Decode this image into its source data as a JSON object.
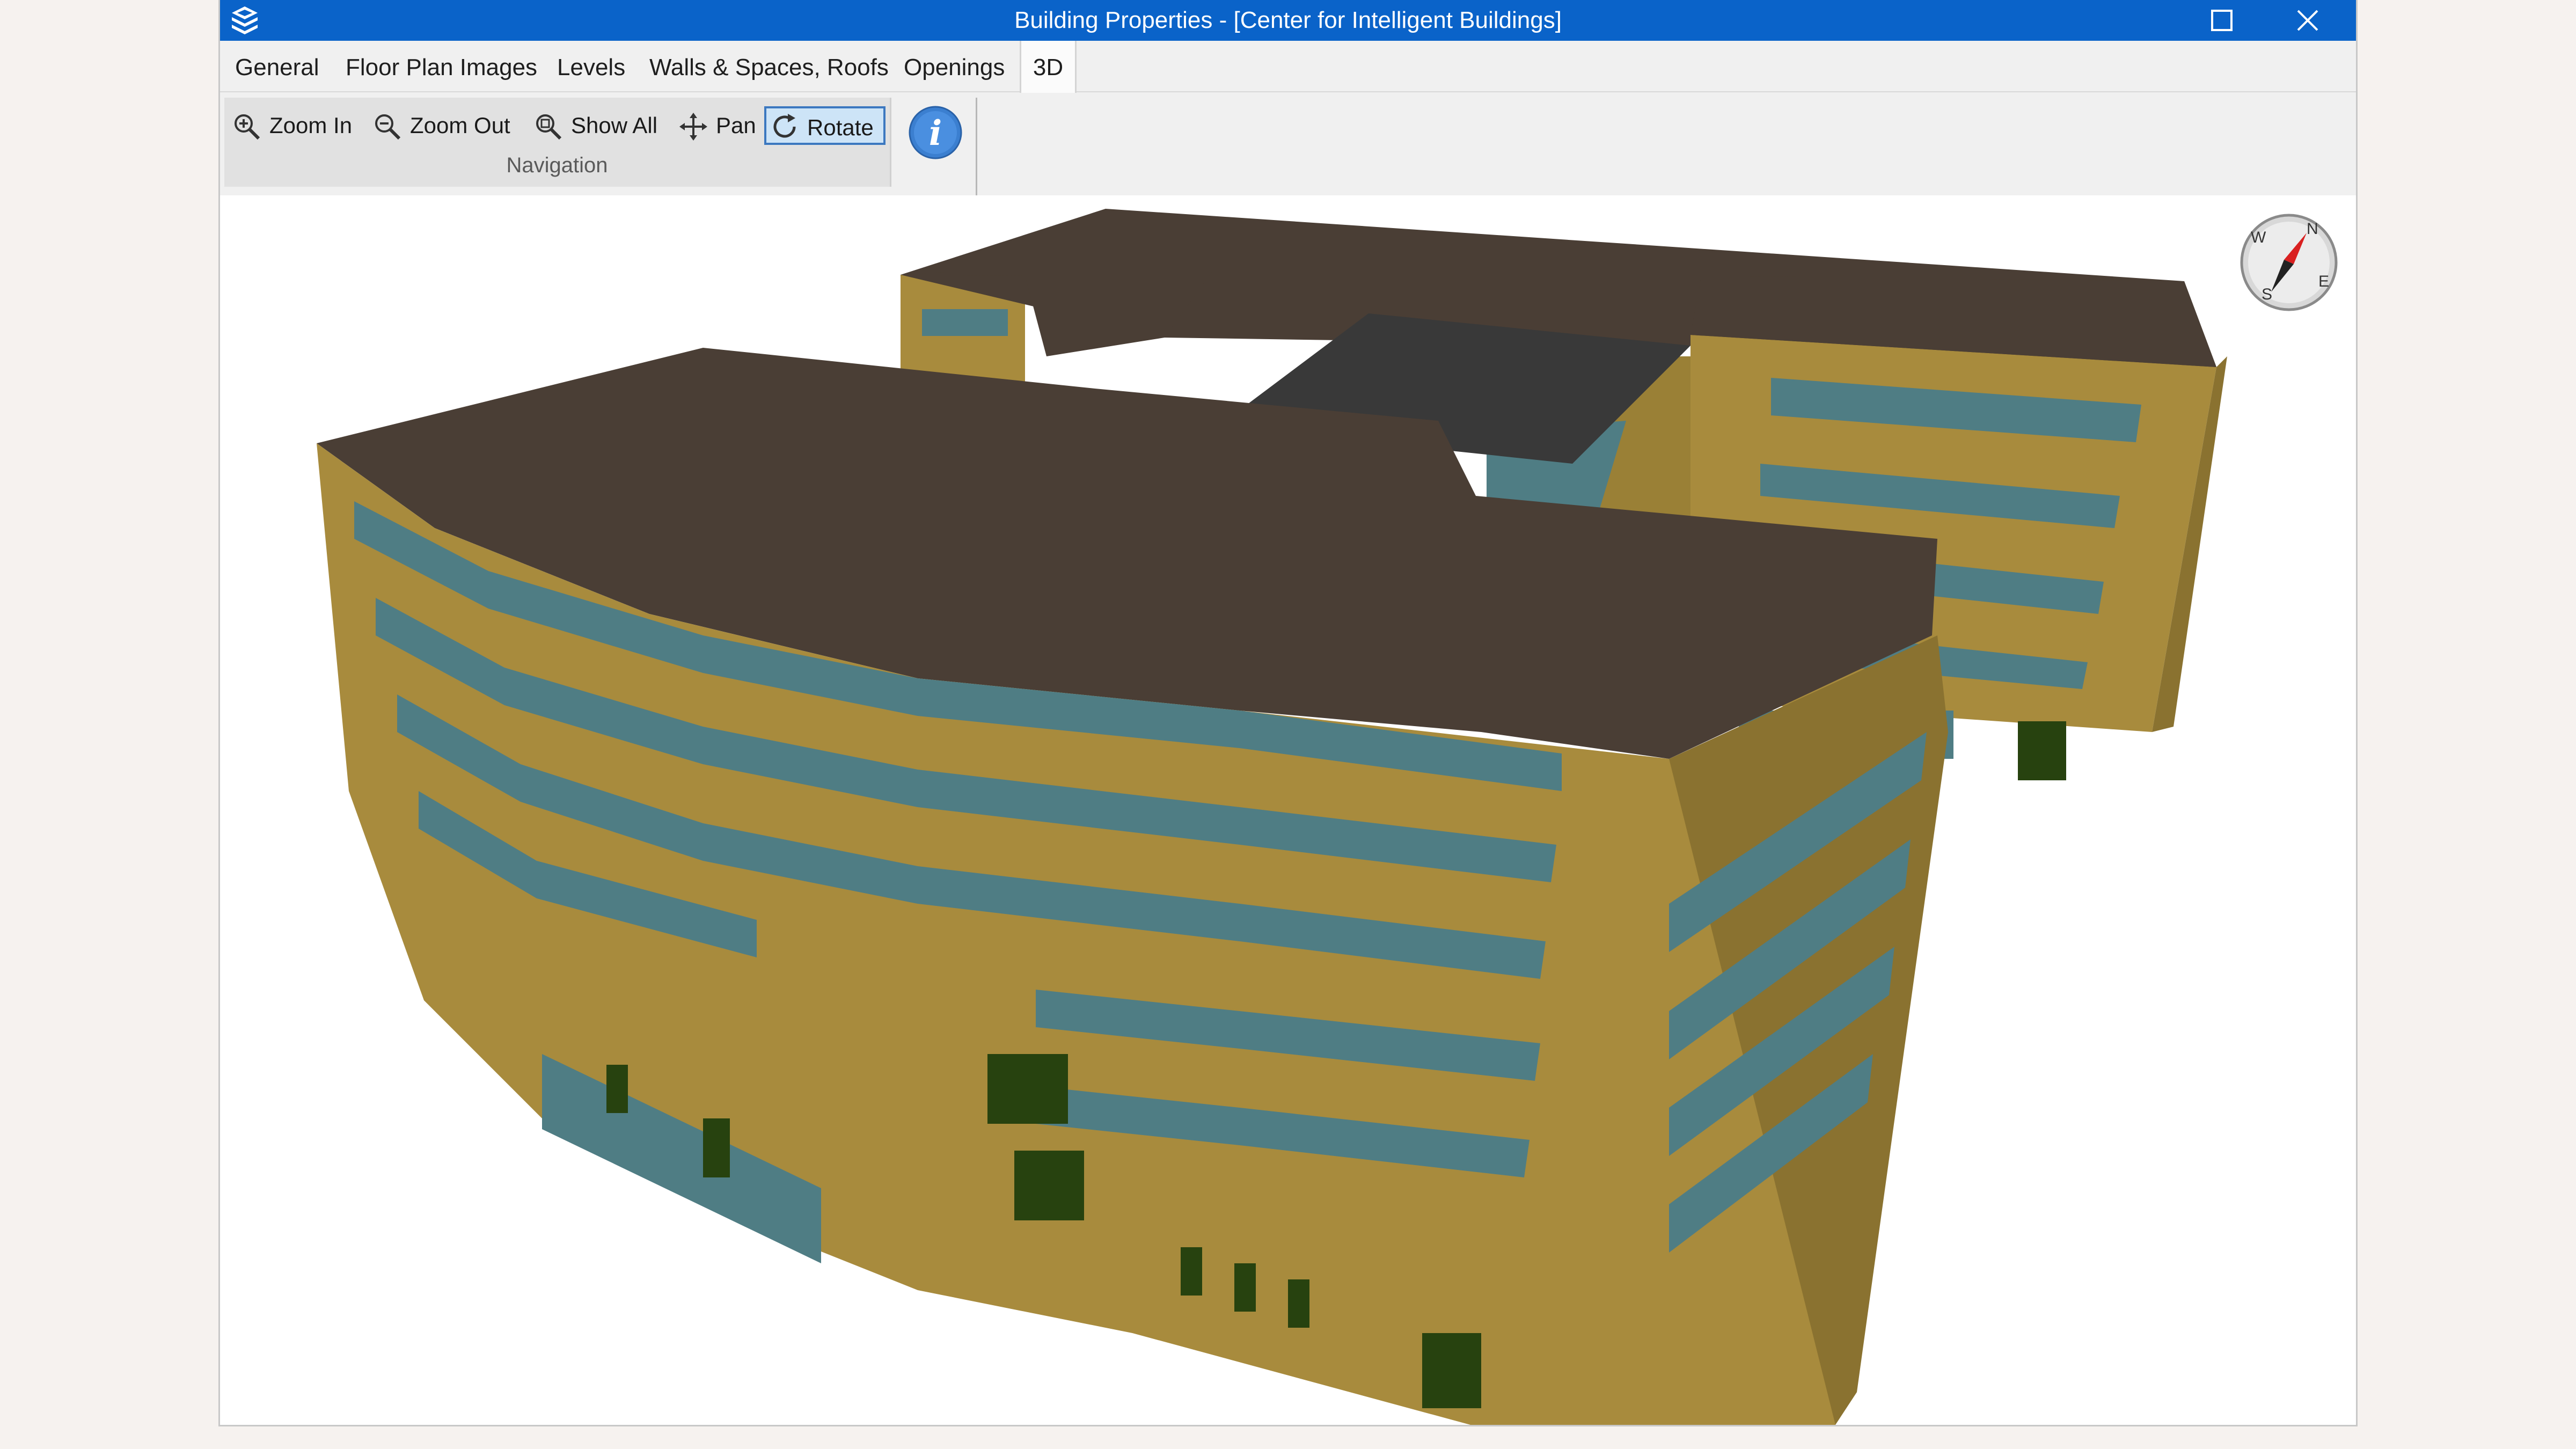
{
  "window": {
    "title": "Building Properties - [Center for Intelligent Buildings]",
    "titlebar_color": "#0a63c9"
  },
  "tabs": [
    {
      "label": "General",
      "active": false
    },
    {
      "label": "Floor Plan Images",
      "active": false
    },
    {
      "label": "Levels",
      "active": false
    },
    {
      "label": "Walls & Spaces, Roofs",
      "active": false
    },
    {
      "label": "Openings",
      "active": false
    },
    {
      "label": "3D",
      "active": true
    }
  ],
  "ribbon": {
    "navigation": {
      "group_label": "Navigation",
      "buttons": [
        {
          "label": "Zoom In",
          "icon": "zoom-in-icon"
        },
        {
          "label": "Zoom Out",
          "icon": "zoom-out-icon"
        },
        {
          "label": "Show All",
          "icon": "show-all-icon"
        },
        {
          "label": "Pan",
          "icon": "pan-icon"
        },
        {
          "label": "Rotate",
          "icon": "rotate-icon",
          "selected": true
        }
      ]
    },
    "info_icon": "info-icon"
  },
  "compass": {
    "n": "N",
    "e": "E",
    "s": "S",
    "w": "W"
  },
  "colors": {
    "roof": "#4a3e35",
    "wall": "#a88b3d",
    "wall_shadow": "#8a7230",
    "glass": "#4f7d84",
    "door": "#27420f",
    "selected_button": "#cde4f7"
  }
}
